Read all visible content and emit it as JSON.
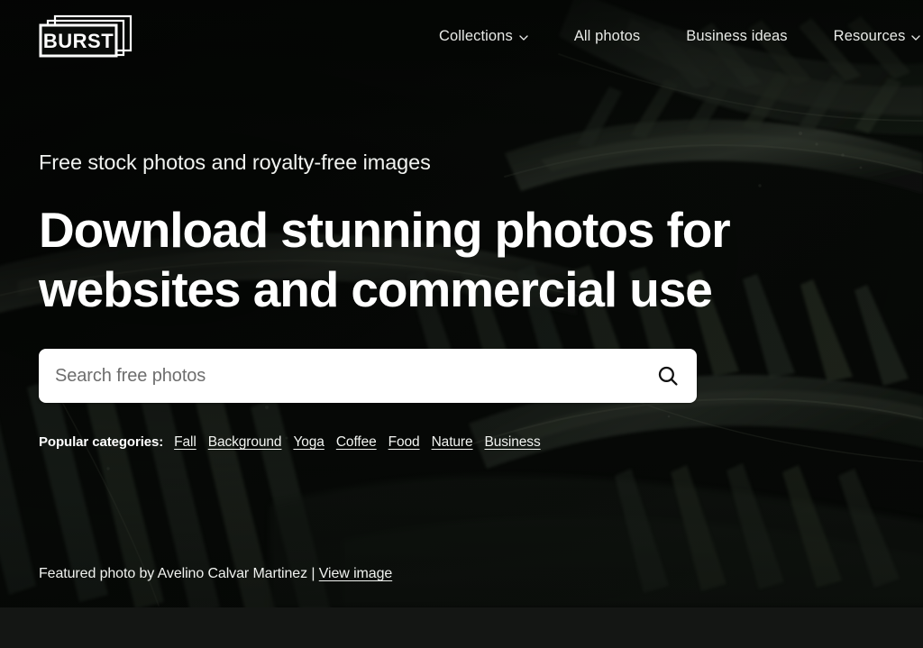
{
  "site": {
    "logo_text": "BURST",
    "logo_icon": "stacked-photo-frames-logo"
  },
  "nav": {
    "items": [
      {
        "label": "Collections",
        "has_dropdown": true,
        "icon": "chevron-down-icon"
      },
      {
        "label": "All photos",
        "has_dropdown": false,
        "icon": ""
      },
      {
        "label": "Business ideas",
        "has_dropdown": false,
        "icon": ""
      },
      {
        "label": "Resources",
        "has_dropdown": true,
        "icon": "chevron-down-icon"
      }
    ]
  },
  "hero": {
    "eyebrow": "Free stock photos and royalty-free images",
    "headline": "Download stunning photos for websites and commercial use",
    "background_image": "dark-fern-palm-fronds-photo"
  },
  "search": {
    "placeholder": "Search free photos",
    "value": "",
    "button_icon": "search-icon"
  },
  "categories": {
    "label": "Popular categories:",
    "items": [
      "Fall",
      "Background",
      "Yoga",
      "Coffee",
      "Food",
      "Nature",
      "Business"
    ]
  },
  "credit": {
    "prefix": "Featured photo by ",
    "photographer": "Avelino Calvar Martinez",
    "separator": " | ",
    "link_label": "View image"
  },
  "colors": {
    "hero_dark": "#090b09",
    "page_background": "#141614",
    "text_on_dark": "#ffffff",
    "search_field_background": "#ffffff",
    "placeholder": "#6e6e6e",
    "foliage_green": "#414b3d"
  }
}
